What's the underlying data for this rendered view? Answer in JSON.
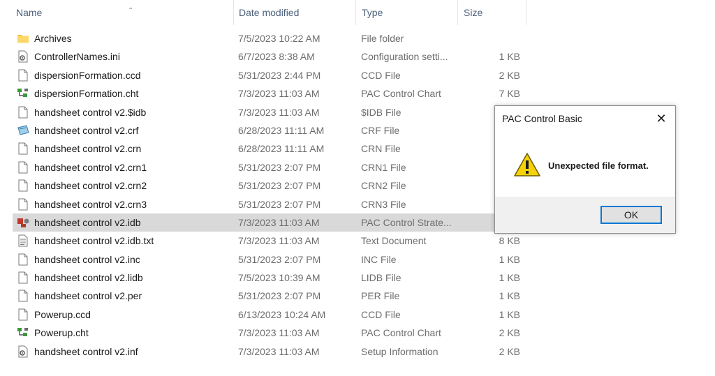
{
  "columns": {
    "name": "Name",
    "date": "Date modified",
    "type": "Type",
    "size": "Size"
  },
  "files": [
    {
      "icon": "folder-icon",
      "name": "Archives",
      "date": "7/5/2023 10:22 AM",
      "type": "File folder",
      "size": ""
    },
    {
      "icon": "config-file-icon",
      "name": "ControllerNames.ini",
      "date": "6/7/2023 8:38 AM",
      "type": "Configuration setti...",
      "size": "1 KB"
    },
    {
      "icon": "file-icon",
      "name": "dispersionFormation.ccd",
      "date": "5/31/2023 2:44 PM",
      "type": "CCD File",
      "size": "2 KB"
    },
    {
      "icon": "chart-file-icon",
      "name": "dispersionFormation.cht",
      "date": "7/3/2023 11:03 AM",
      "type": "PAC Control Chart",
      "size": "7 KB"
    },
    {
      "icon": "file-icon",
      "name": "handsheet control v2.$idb",
      "date": "7/3/2023 11:03 AM",
      "type": "$IDB File",
      "size": ""
    },
    {
      "icon": "crf-file-icon",
      "name": "handsheet control v2.crf",
      "date": "6/28/2023 11:11 AM",
      "type": "CRF File",
      "size": ""
    },
    {
      "icon": "file-icon",
      "name": "handsheet control v2.crn",
      "date": "6/28/2023 11:11 AM",
      "type": "CRN File",
      "size": ""
    },
    {
      "icon": "file-icon",
      "name": "handsheet control v2.crn1",
      "date": "5/31/2023 2:07 PM",
      "type": "CRN1 File",
      "size": ""
    },
    {
      "icon": "file-icon",
      "name": "handsheet control v2.crn2",
      "date": "5/31/2023 2:07 PM",
      "type": "CRN2 File",
      "size": ""
    },
    {
      "icon": "file-icon",
      "name": "handsheet control v2.crn3",
      "date": "5/31/2023 2:07 PM",
      "type": "CRN3 File",
      "size": ""
    },
    {
      "icon": "strategy-file-icon",
      "name": "handsheet control v2.idb",
      "date": "7/3/2023 11:03 AM",
      "type": "PAC Control Strate...",
      "size": "",
      "selected": true
    },
    {
      "icon": "text-file-icon",
      "name": "handsheet control v2.idb.txt",
      "date": "7/3/2023 11:03 AM",
      "type": "Text Document",
      "size": "8 KB"
    },
    {
      "icon": "file-icon",
      "name": "handsheet control v2.inc",
      "date": "5/31/2023 2:07 PM",
      "type": "INC File",
      "size": "1 KB"
    },
    {
      "icon": "file-icon",
      "name": "handsheet control v2.lidb",
      "date": "7/5/2023 10:39 AM",
      "type": "LIDB File",
      "size": "1 KB"
    },
    {
      "icon": "file-icon",
      "name": "handsheet control v2.per",
      "date": "5/31/2023 2:07 PM",
      "type": "PER File",
      "size": "1 KB"
    },
    {
      "icon": "file-icon",
      "name": "Powerup.ccd",
      "date": "6/13/2023 10:24 AM",
      "type": "CCD File",
      "size": "1 KB"
    },
    {
      "icon": "chart-file-icon",
      "name": "Powerup.cht",
      "date": "7/3/2023 11:03 AM",
      "type": "PAC Control Chart",
      "size": "2 KB"
    },
    {
      "icon": "config-file-icon",
      "name": "handsheet control v2.inf",
      "date": "7/3/2023 11:03 AM",
      "type": "Setup Information",
      "size": "2 KB"
    }
  ],
  "dialog": {
    "title": "PAC Control Basic",
    "close_symbol": "✕",
    "message": "Unexpected file format.",
    "ok_label": "OK",
    "icon": "warning-icon"
  },
  "colors": {
    "selected_row": "#d9d9d9",
    "header_text": "#4c607a",
    "ok_border": "#0078d7",
    "warning_yellow": "#f5d10a"
  }
}
